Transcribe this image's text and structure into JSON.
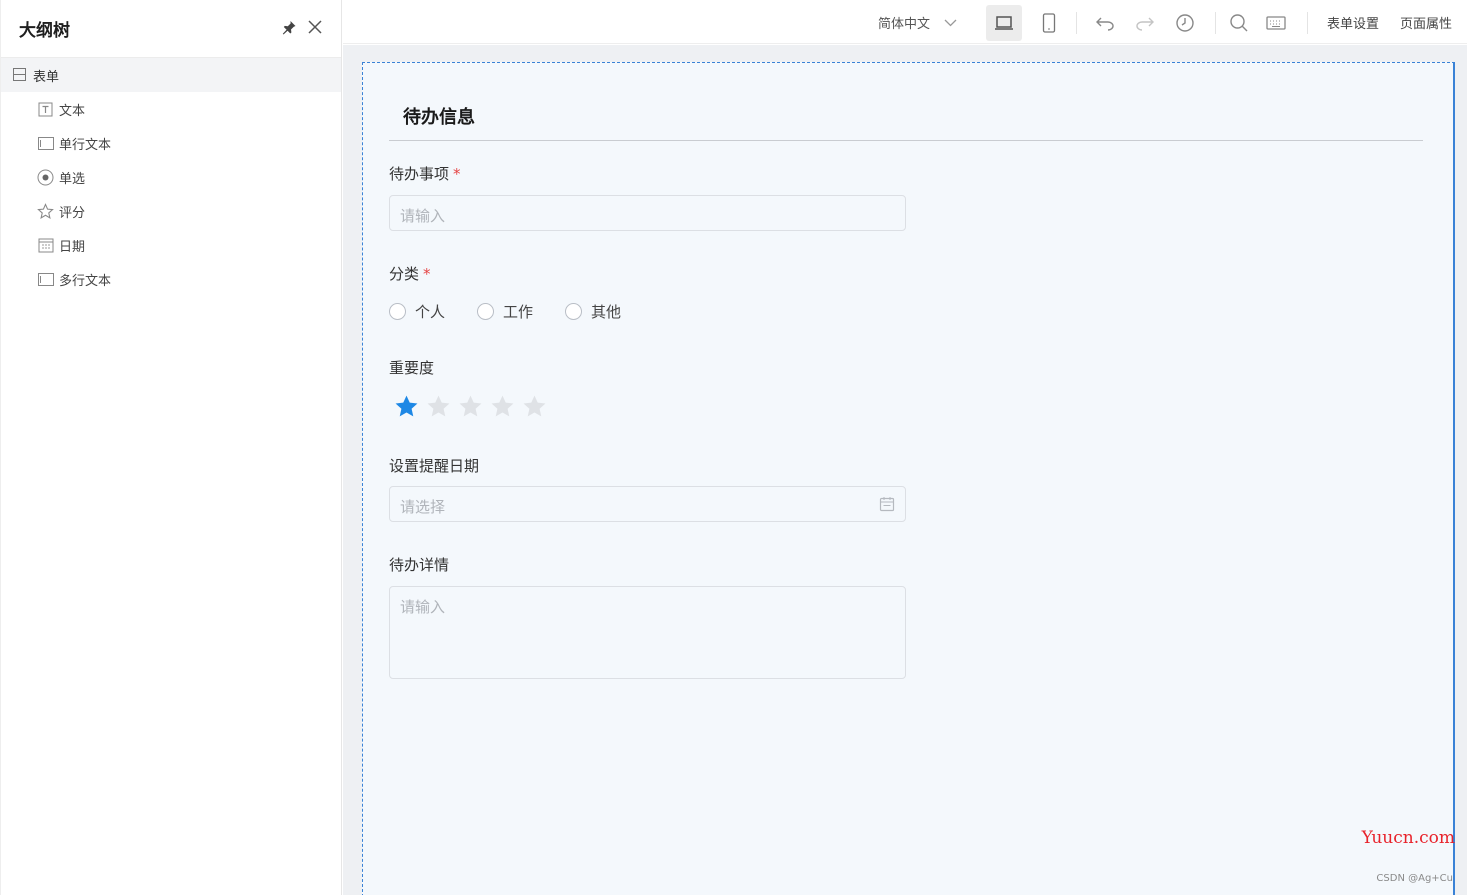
{
  "outline": {
    "title": "大纲树",
    "root": {
      "label": "表单",
      "icon": "form-icon"
    },
    "items": [
      {
        "label": "文本",
        "icon": "text-icon"
      },
      {
        "label": "单行文本",
        "icon": "input-icon"
      },
      {
        "label": "单选",
        "icon": "radio-icon"
      },
      {
        "label": "评分",
        "icon": "star-icon"
      },
      {
        "label": "日期",
        "icon": "calendar-icon"
      },
      {
        "label": "多行文本",
        "icon": "textarea-icon"
      }
    ]
  },
  "toolbar": {
    "language": "简体中文",
    "form_settings": "表单设置",
    "page_properties": "页面属性"
  },
  "form": {
    "section_title": "待办信息",
    "todo_label": "待办事项",
    "todo_placeholder": "请输入",
    "category_label": "分类",
    "category_options": [
      "个人",
      "工作",
      "其他"
    ],
    "importance_label": "重要度",
    "importance_rating": 1,
    "importance_max": 5,
    "reminder_label": "设置提醒日期",
    "reminder_placeholder": "请选择",
    "details_label": "待办详情",
    "details_placeholder": "请输入",
    "required_mark": "*"
  },
  "colors": {
    "accent": "#1e88e5",
    "required": "#e54545",
    "star_empty": "#dfe2e6"
  },
  "watermark": "Yuucn.com",
  "credit": "CSDN @Ag+Cu"
}
